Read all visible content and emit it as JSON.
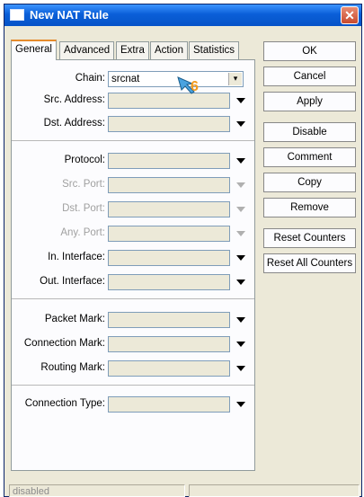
{
  "window": {
    "title": "New NAT Rule",
    "close_symbol": "✕"
  },
  "tabs": [
    "General",
    "Advanced",
    "Extra",
    "Action",
    "Statistics"
  ],
  "active_tab": "General",
  "fields": {
    "chain": {
      "label": "Chain:",
      "value": "srcnat",
      "spin_symbol": "▾"
    },
    "src_address": {
      "label": "Src. Address:",
      "value": ""
    },
    "dst_address": {
      "label": "Dst. Address:",
      "value": ""
    },
    "protocol": {
      "label": "Protocol:",
      "value": ""
    },
    "src_port": {
      "label": "Src. Port:",
      "value": ""
    },
    "dst_port": {
      "label": "Dst. Port:",
      "value": ""
    },
    "any_port": {
      "label": "Any. Port:",
      "value": ""
    },
    "in_interface": {
      "label": "In. Interface:",
      "value": ""
    },
    "out_interface": {
      "label": "Out. Interface:",
      "value": ""
    },
    "packet_mark": {
      "label": "Packet Mark:",
      "value": ""
    },
    "connection_mark": {
      "label": "Connection Mark:",
      "value": ""
    },
    "routing_mark": {
      "label": "Routing Mark:",
      "value": ""
    },
    "connection_type": {
      "label": "Connection Type:",
      "value": ""
    }
  },
  "buttons": {
    "ok": "OK",
    "cancel": "Cancel",
    "apply": "Apply",
    "disable": "Disable",
    "comment": "Comment",
    "copy": "Copy",
    "remove": "Remove",
    "reset_counters": "Reset Counters",
    "reset_all_counters": "Reset All Counters"
  },
  "status": {
    "text": "disabled"
  },
  "annotation": {
    "step_number": "6"
  },
  "colors": {
    "title_bar": "#0a5fd8",
    "annotation": "#f29b1e",
    "active_tab_highlight": "#e68b2c"
  }
}
